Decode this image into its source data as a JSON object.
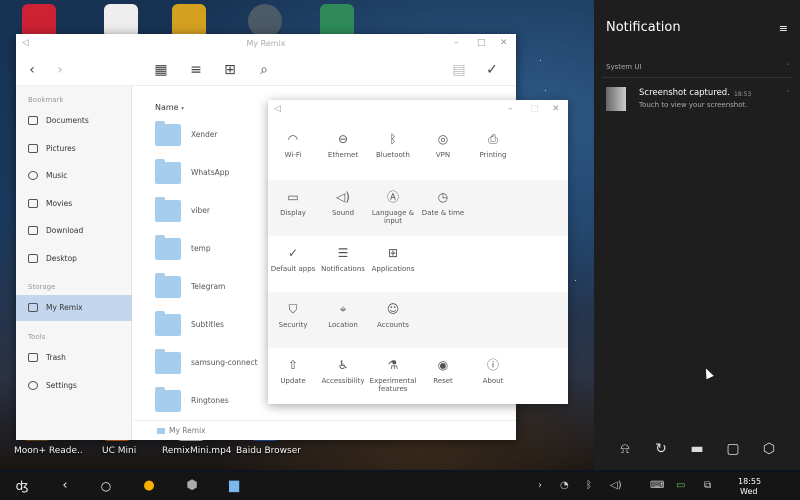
{
  "desktop": {
    "icons": [
      {
        "label": "Moon+ Reade..",
        "icon": "moon-reader-icon"
      },
      {
        "label": "UC Mini",
        "icon": "uc-mini-icon"
      },
      {
        "label": "RemixMini.mp4",
        "icon": "video-file-icon"
      },
      {
        "label": "Baidu Browser",
        "icon": "baidu-browser-icon"
      }
    ]
  },
  "file_manager": {
    "title": "My Remix",
    "column_header": "Name",
    "sidebar": {
      "sections": [
        "Bookmark",
        "Storage",
        "Tools"
      ],
      "items": [
        {
          "label": "Documents",
          "icon": "document-icon"
        },
        {
          "label": "Pictures",
          "icon": "picture-icon"
        },
        {
          "label": "Music",
          "icon": "music-icon"
        },
        {
          "label": "Movies",
          "icon": "movie-icon"
        },
        {
          "label": "Download",
          "icon": "download-icon"
        },
        {
          "label": "Desktop",
          "icon": "desktop-icon"
        },
        {
          "label": "My Remix",
          "icon": "monitor-icon",
          "active": true
        },
        {
          "label": "Trash",
          "icon": "trash-icon"
        },
        {
          "label": "Settings",
          "icon": "gear-icon"
        }
      ]
    },
    "folders": [
      "Xender",
      "WhatsApp",
      "viber",
      "temp",
      "Telegram",
      "Subtitles",
      "samsung-connect",
      "Ringtones"
    ],
    "status_path": "My Remix"
  },
  "settings": {
    "rows": [
      [
        {
          "label": "Wi-Fi",
          "icon": "wifi-icon"
        },
        {
          "label": "Ethernet",
          "icon": "ethernet-icon"
        },
        {
          "label": "Bluetooth",
          "icon": "bluetooth-icon"
        },
        {
          "label": "VPN",
          "icon": "vpn-icon"
        },
        {
          "label": "Printing",
          "icon": "printer-icon"
        }
      ],
      [
        {
          "label": "Display",
          "icon": "display-icon"
        },
        {
          "label": "Sound",
          "icon": "sound-icon"
        },
        {
          "label": "Language & input",
          "icon": "language-icon"
        },
        {
          "label": "Date & time",
          "icon": "clock-icon"
        }
      ],
      [
        {
          "label": "Default apps",
          "icon": "check-circle-icon"
        },
        {
          "label": "Notifications",
          "icon": "notification-icon"
        },
        {
          "label": "Applications",
          "icon": "apps-grid-icon"
        }
      ],
      [
        {
          "label": "Security",
          "icon": "shield-icon"
        },
        {
          "label": "Location",
          "icon": "location-icon"
        },
        {
          "label": "Accounts",
          "icon": "account-icon"
        }
      ],
      [
        {
          "label": "Update",
          "icon": "update-icon"
        },
        {
          "label": "Accessibility",
          "icon": "accessibility-icon"
        },
        {
          "label": "Experimental features",
          "icon": "flask-icon"
        },
        {
          "label": "Reset",
          "icon": "reset-icon"
        },
        {
          "label": "About",
          "icon": "info-icon"
        }
      ]
    ]
  },
  "notification_panel": {
    "title": "Notification",
    "group": "System UI",
    "notification": {
      "title": "Screenshot captured.",
      "time": "18:53",
      "body": "Touch to view your screenshot."
    },
    "quick_settings": [
      "do-not-disturb-icon",
      "rotate-icon",
      "screenshot-icon",
      "window-icon",
      "settings-hex-icon"
    ]
  },
  "taskbar": {
    "clock": "18:55",
    "day": "Wed"
  }
}
